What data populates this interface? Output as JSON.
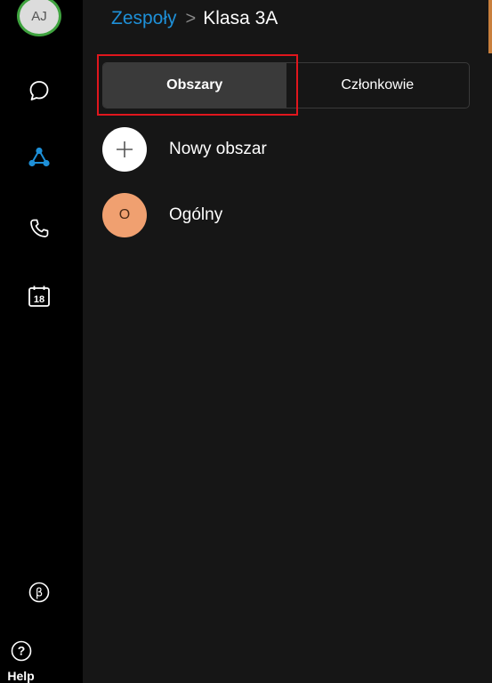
{
  "user": {
    "initials": "AJ"
  },
  "rail": {
    "icons": [
      "chat-icon",
      "teams-icon",
      "phone-icon",
      "calendar-icon",
      "beta-icon",
      "help-icon"
    ],
    "calendar_day": "18",
    "beta_symbol": "β",
    "help_symbol": "?",
    "help_label": "Help",
    "active_color": "#1e90d8"
  },
  "header": {
    "parent": "Zespoły",
    "separator": ">",
    "current": "Klasa 3A"
  },
  "tabs": [
    {
      "label": "Obszary",
      "active": true
    },
    {
      "label": "Członkowie",
      "active": false
    }
  ],
  "spaces": [
    {
      "avatar": "+",
      "label": "Nowy obszar"
    },
    {
      "avatar": "O",
      "label": "Ogólny"
    }
  ],
  "colors": {
    "link": "#1e90d8",
    "highlight": "#e0161d",
    "space_avatar": "#f0a070",
    "presence": "#3fa33f"
  }
}
